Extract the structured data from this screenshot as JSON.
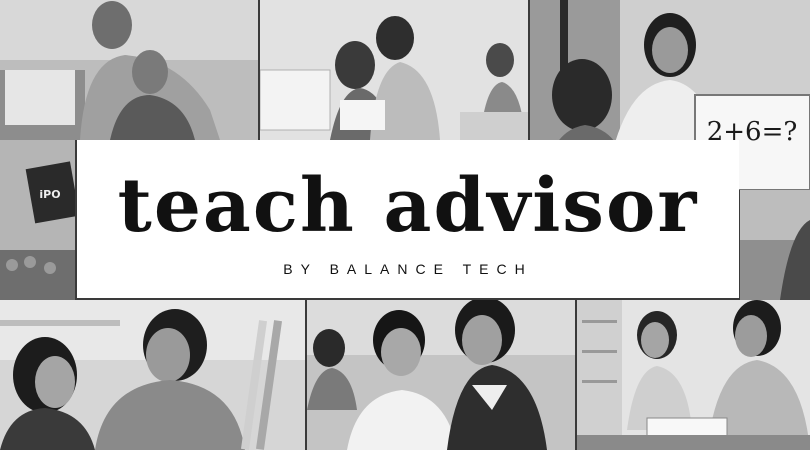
{
  "banner": {
    "title": "teach advisor",
    "subtitle": "BY BALANCE TECH"
  },
  "photos": {
    "t3_board_text": "2+6=?",
    "t4_label": "iPO"
  },
  "colors": {
    "banner_bg": "#ffffff",
    "text": "#111111",
    "photo_tone": "grayscale"
  }
}
